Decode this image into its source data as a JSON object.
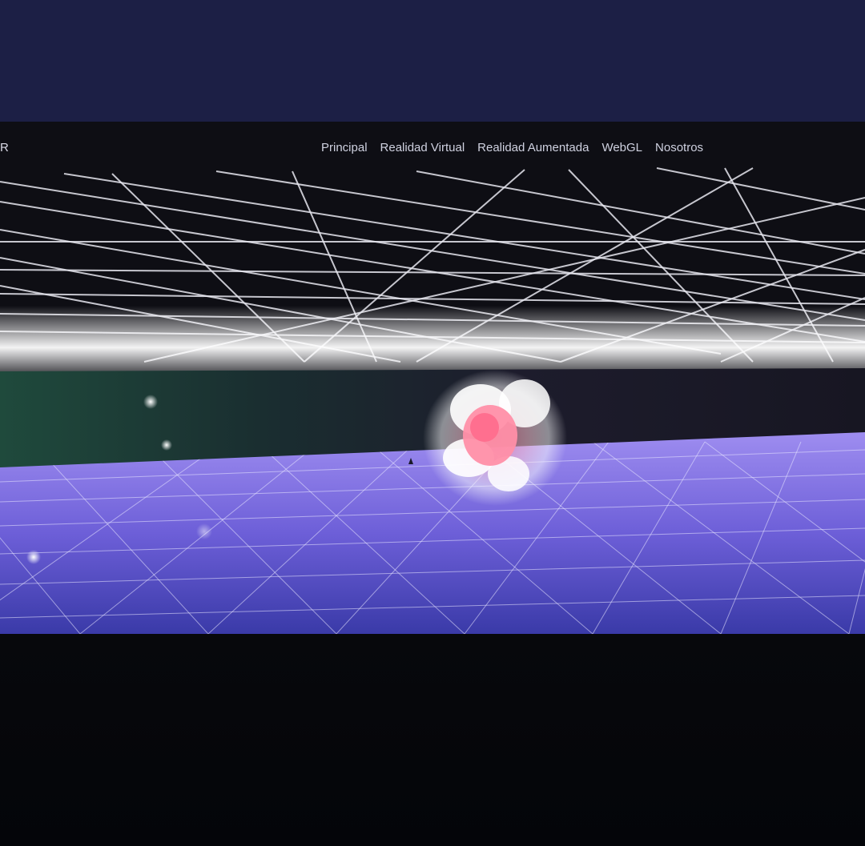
{
  "site": {
    "brand": "R"
  },
  "nav": {
    "items": [
      {
        "label": "Principal"
      },
      {
        "label": "Realidad Virtual"
      },
      {
        "label": "Realidad Aumentada"
      },
      {
        "label": "WebGL"
      },
      {
        "label": "Nosotros"
      }
    ]
  },
  "colors": {
    "frame_top": "#1c1f45",
    "floor": "#6f63e0",
    "ceiling_grid": "#e8e8f0",
    "glow": "#ffffff",
    "orb": "#ff8fa8"
  }
}
